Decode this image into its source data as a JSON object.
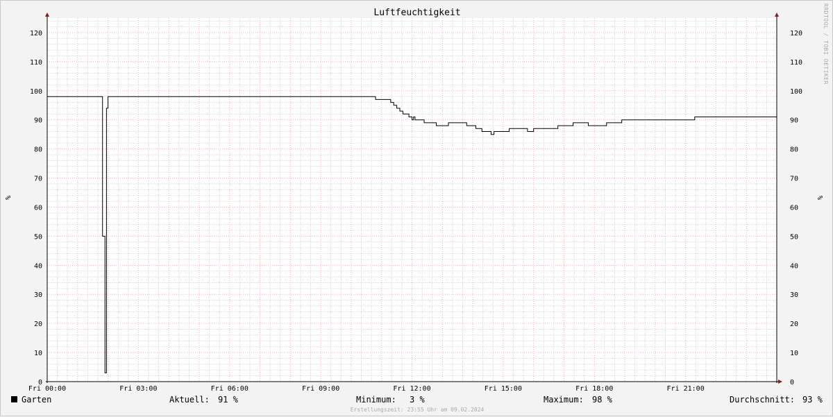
{
  "title": "Luftfeuchtigkeit",
  "watermark": "RRDTOOL / TOBI OETIKER",
  "unit": "%",
  "legend": {
    "series_name": "Garten",
    "current_label": "Aktuell:",
    "current_value": "91 %",
    "min_label": "Minimum:",
    "min_value": "3 %",
    "max_label": "Maximum:",
    "max_value": "98 %",
    "avg_label": "Durchschnitt:",
    "avg_value": "93 %"
  },
  "footer": "Erstellungszeit: 23:55 Uhr am 09.02.2024",
  "colors": {
    "grid_major": "#f0b0b0",
    "grid_minor": "#d8d8d8",
    "line": "#000000",
    "axis_arrow": "#8b1a1a"
  },
  "chart_data": {
    "type": "line",
    "title": "Luftfeuchtigkeit",
    "ylabel": "%",
    "xlim": [
      0,
      24
    ],
    "ylim": [
      0,
      125
    ],
    "y_ticks": [
      0,
      10,
      20,
      30,
      40,
      50,
      60,
      70,
      80,
      90,
      100,
      110,
      120
    ],
    "x_ticks": [
      0,
      3,
      6,
      9,
      12,
      15,
      18,
      21
    ],
    "x_tick_labels": [
      "Fri 00:00",
      "Fri 03:00",
      "Fri 06:00",
      "Fri 09:00",
      "Fri 12:00",
      "Fri 15:00",
      "Fri 18:00",
      "Fri 21:00"
    ],
    "grid": true,
    "series": [
      {
        "name": "Garten",
        "x": [
          0,
          1.8,
          1.82,
          1.9,
          1.92,
          1.95,
          2.0,
          10.8,
          10.8,
          11.3,
          11.3,
          11.4,
          11.5,
          11.6,
          11.7,
          11.8,
          11.9,
          12.0,
          12.05,
          12.1,
          12.2,
          12.4,
          12.8,
          13.2,
          13.8,
          14.1,
          14.3,
          14.5,
          14.6,
          14.65,
          14.7,
          15.0,
          15.2,
          15.5,
          15.8,
          16.0,
          16.5,
          16.8,
          17.3,
          17.8,
          18.4,
          18.9,
          20.5,
          21.2,
          21.3,
          22.0,
          24.0
        ],
        "y": [
          98,
          98,
          50,
          3,
          3,
          94,
          98,
          98,
          97,
          97,
          96,
          95,
          94,
          93,
          92,
          92,
          91,
          90,
          91,
          90,
          90,
          89,
          88,
          89,
          88,
          87,
          86,
          86,
          85,
          85,
          86,
          86,
          87,
          87,
          86,
          87,
          87,
          88,
          89,
          88,
          89,
          90,
          90,
          90,
          91,
          91,
          91
        ]
      }
    ]
  }
}
